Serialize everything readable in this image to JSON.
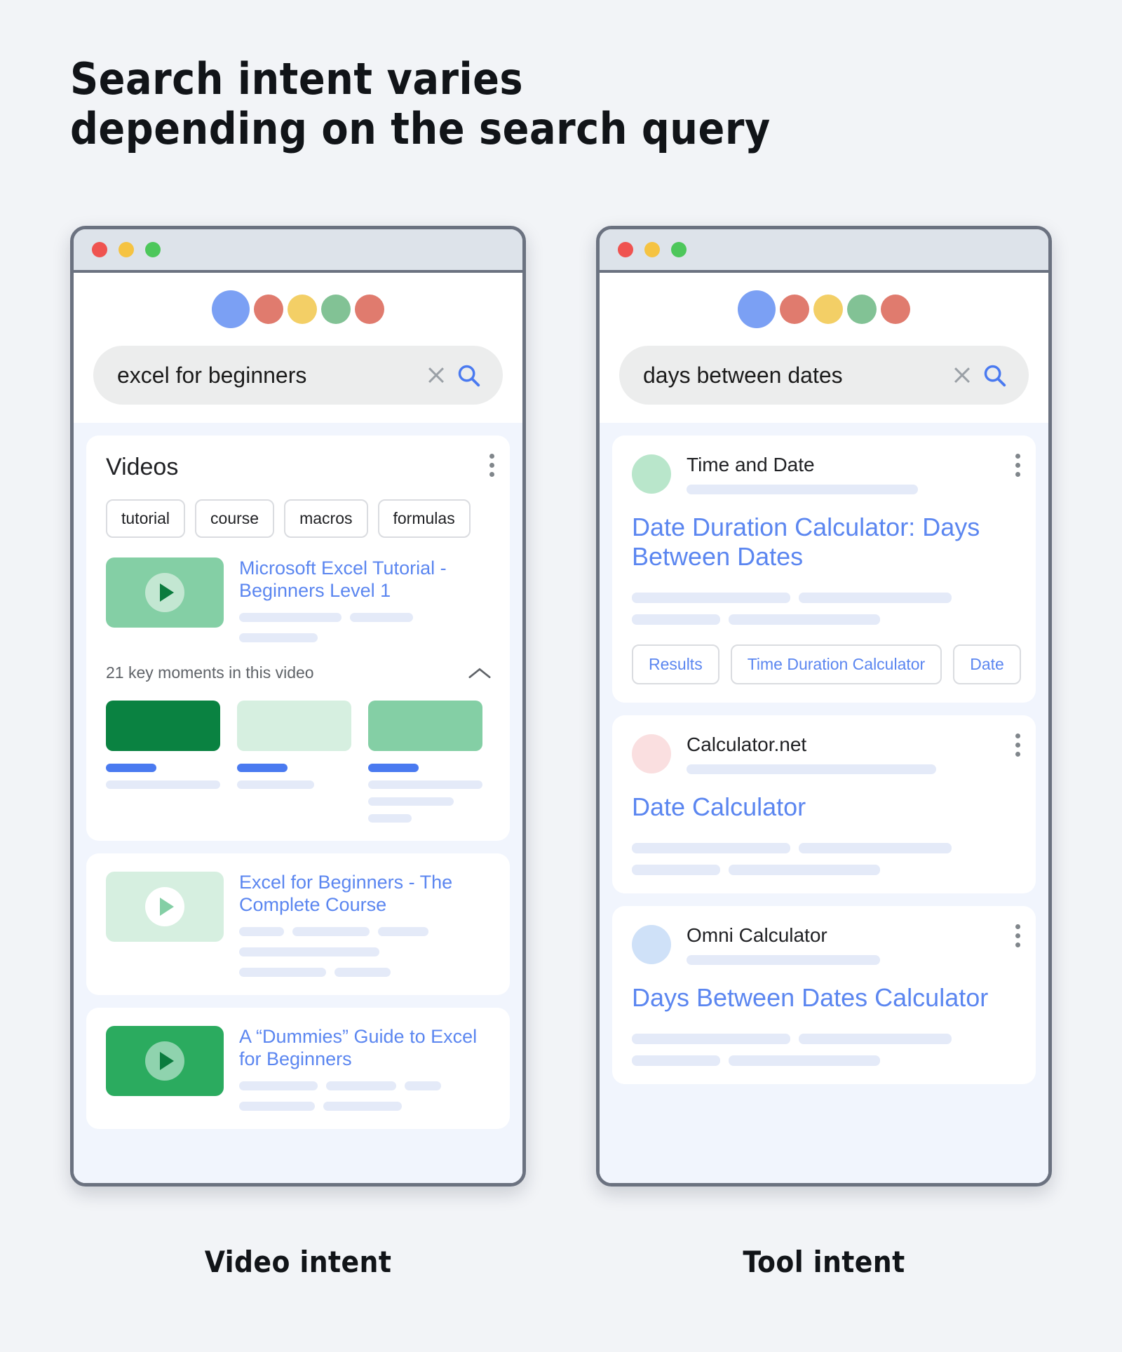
{
  "heading": "Search intent varies\ndepending on the search query",
  "colors": {
    "link_blue": "#5b86f0",
    "bar_blue": "#4a7af0",
    "skeleton": "#e4eaf8",
    "results_bg": "#f1f5fd",
    "page_bg": "#f2f4f7",
    "titlebar": "#dde3ea",
    "chrome_border": "#6b7280"
  },
  "window_controls": [
    {
      "name": "close",
      "color": "#ef5350"
    },
    {
      "name": "minimize",
      "color": "#f5c342"
    },
    {
      "name": "maximize",
      "color": "#4dc75b"
    }
  ],
  "logo_dots": [
    "#7ba0f4",
    "#e07b6e",
    "#f3cf66",
    "#82c295",
    "#e07b6e"
  ],
  "left_phone": {
    "caption": "Video intent",
    "search": {
      "query": "excel for beginners",
      "placeholder": "Search",
      "clear_icon": "close-icon",
      "search_icon": "search-icon"
    },
    "videos_card": {
      "heading": "Videos",
      "menu_icon": "kebab-menu-icon",
      "chips": [
        "tutorial",
        "course",
        "macros",
        "formulas"
      ],
      "video": {
        "title": "Microsoft Excel Tutorial - Beginners Level 1",
        "thumb_color": "#84cfa5",
        "play_circle_color": "#c3e7d2",
        "play_triangle_color": "#0b7b3e"
      },
      "key_moments": {
        "label": "21 key moments in this video",
        "count": 21,
        "collapse_icon": "chevron-up-icon",
        "items": [
          {
            "thumb_color": "#0a8241"
          },
          {
            "thumb_color": "#d6efe0"
          },
          {
            "thumb_color": "#84cfa5"
          },
          {
            "thumb_color": "#2bab5f"
          },
          {
            "thumb_color": "#0a8241"
          }
        ]
      }
    },
    "results": [
      {
        "title": "Excel for Beginners - The Complete Course",
        "thumb_color": "#d6efe0",
        "play_circle_color": "#ffffff",
        "play_triangle_color": "#84cfa5"
      },
      {
        "title": "A “Dummies” Guide to Excel for Beginners",
        "thumb_color": "#2bab5f",
        "play_circle_color": "#8fd3ae",
        "play_triangle_color": "#0b7b3e"
      }
    ]
  },
  "right_phone": {
    "caption": "Tool intent",
    "search": {
      "query": "days between dates",
      "placeholder": "Search",
      "clear_icon": "close-icon",
      "search_icon": "search-icon"
    },
    "results": [
      {
        "site_name": "Time and Date",
        "favicon_color": "#b9e6cb",
        "title": "Date Duration Calculator: Days Between Dates",
        "menu_icon": "kebab-menu-icon",
        "sitelinks": [
          "Results",
          "Time Duration Calculator",
          "Date"
        ]
      },
      {
        "site_name": "Calculator.net",
        "favicon_color": "#fadfe0",
        "title": "Date Calculator",
        "menu_icon": "kebab-menu-icon",
        "sitelinks": []
      },
      {
        "site_name": "Omni Calculator",
        "favicon_color": "#cfe1f8",
        "title": "Days Between Dates Calculator",
        "menu_icon": "kebab-menu-icon",
        "sitelinks": []
      }
    ]
  }
}
